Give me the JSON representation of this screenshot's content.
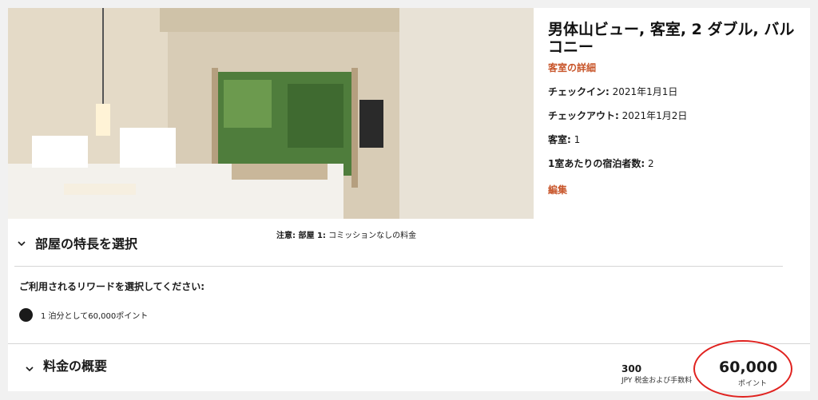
{
  "room": {
    "title": "男体山ビュー, 客室, 2 ダブル, バルコニー",
    "details_link": "客室の詳細",
    "checkin_label": "チェックイン:",
    "checkin_value": " 2021年1月1日",
    "checkout_label": "チェックアウト:",
    "checkout_value": " 2021年1月2日",
    "rooms_label": "客室:",
    "rooms_value": " 1",
    "guests_label": "1室あたりの宿泊者数:",
    "guests_value": " 2",
    "edit_link": "編集",
    "photo_icon": "room-photo"
  },
  "features": {
    "title": "部屋の特長を選択",
    "note_label": "注意: 部屋 1:",
    "note_value": " コミッションなしの料金",
    "chevron_icon": "chevron-down-icon"
  },
  "reward": {
    "heading": "ご利用されるリワードを選択してください:",
    "option_label": "1 泊分として60,000ポイント",
    "selected": true
  },
  "summary": {
    "title": "料金の概要",
    "tax_amount": "300",
    "tax_label": "JPY 税金および手数料",
    "points_total": "60,000",
    "points_unit": "ポイント"
  },
  "colors": {
    "accent": "#c8552a",
    "highlight": "#e0221f"
  }
}
